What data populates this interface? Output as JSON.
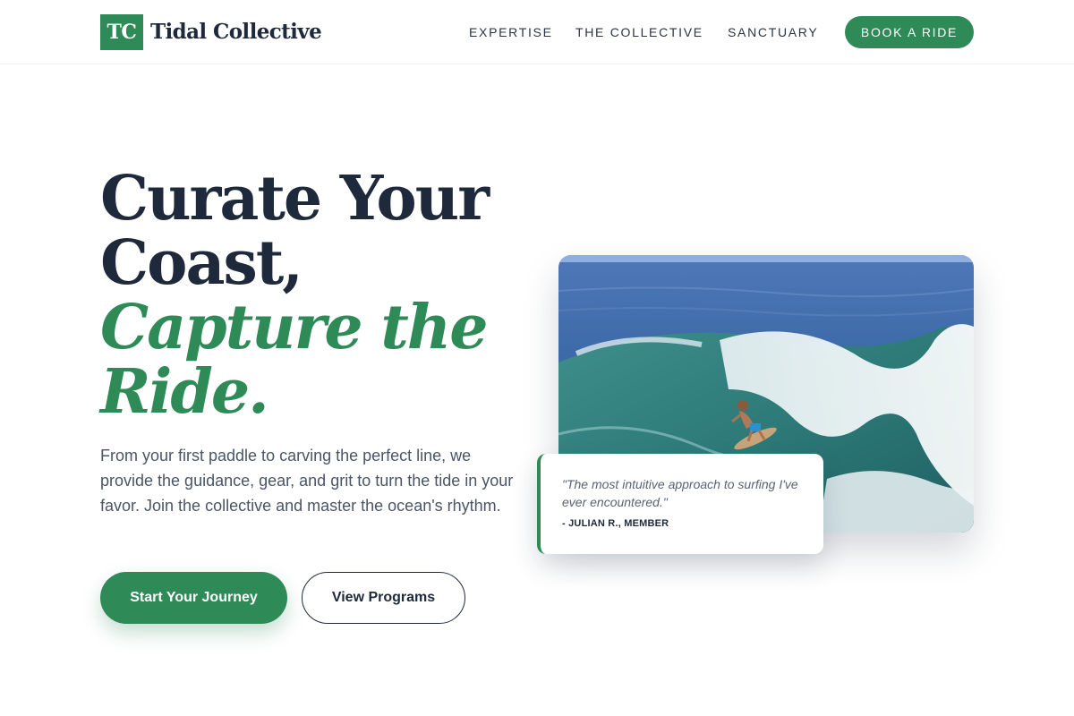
{
  "brand": {
    "mark": "TC",
    "name": "Tidal Collective",
    "accent_color": "#2e8a57",
    "text_color": "#1e2a3b"
  },
  "nav": {
    "items": [
      {
        "label": "EXPERTISE"
      },
      {
        "label": "THE COLLECTIVE"
      },
      {
        "label": "SANCTUARY"
      }
    ],
    "cta_label": "BOOK A RIDE"
  },
  "hero": {
    "headline_line1": "Curate Your",
    "headline_line2": "Coast,",
    "headline_accent_line1": "Capture the",
    "headline_accent_line2": "Ride.",
    "description": "From your first paddle to carving the perfect line, we provide the guidance, gear, and grit to turn the tide in your favor. Join the collective and master the ocean's rhythm.",
    "primary_cta": "Start Your Journey",
    "secondary_cta": "View Programs",
    "image": {
      "icon": "surfer-wave-photo"
    }
  },
  "testimonial": {
    "quote": "\"The most intuitive approach to surfing I've ever encountered.\"",
    "author": "- JULIAN R., MEMBER"
  }
}
